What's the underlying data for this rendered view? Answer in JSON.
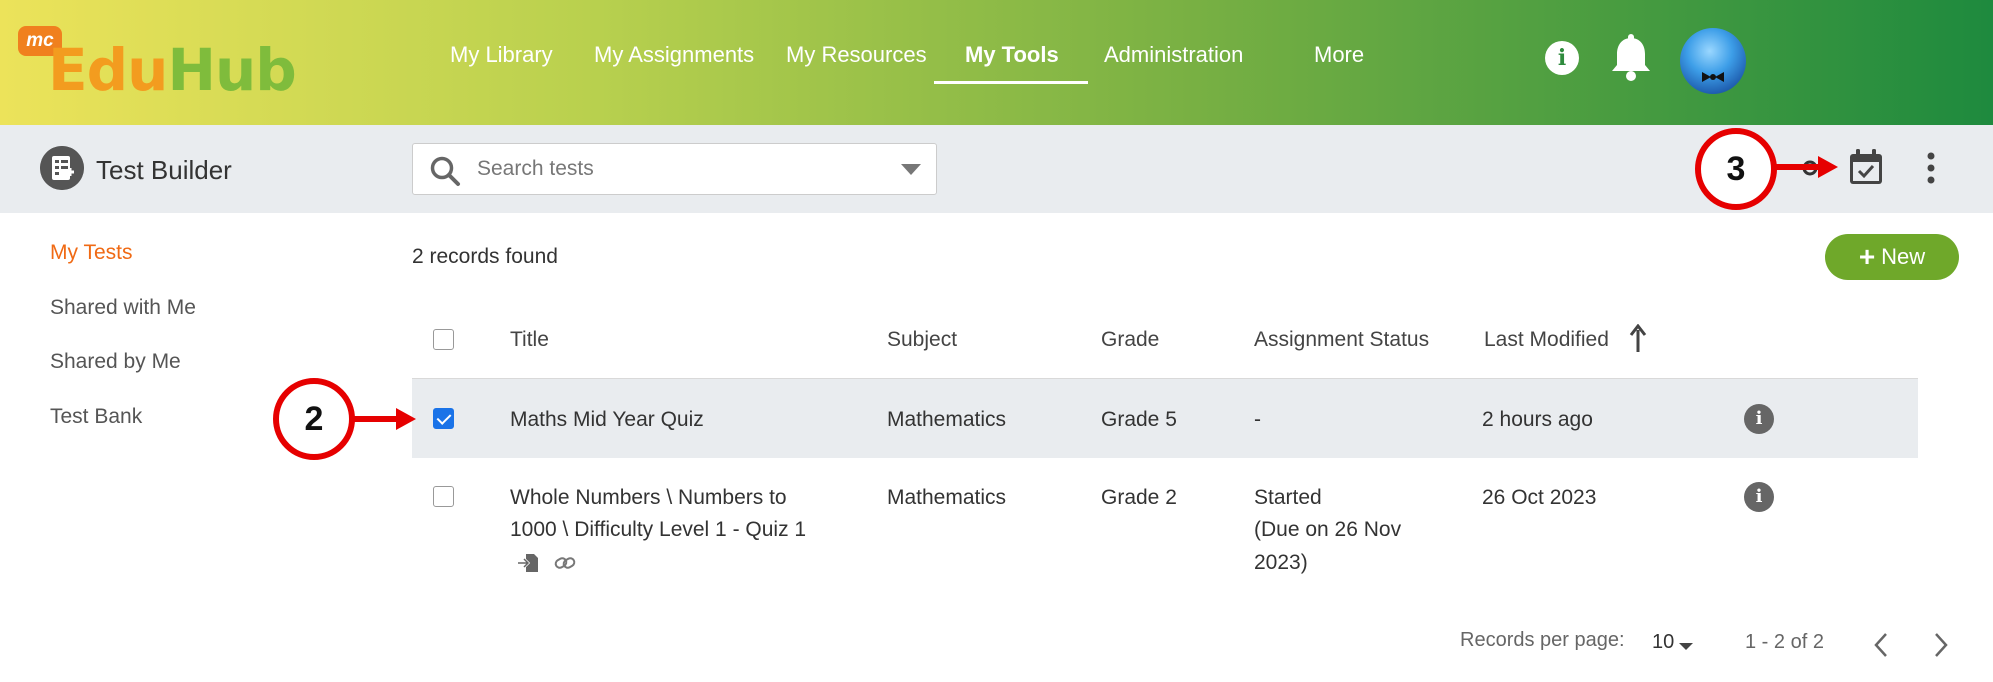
{
  "app": {
    "brand_badge": "mc",
    "brand_part1": "Edu",
    "brand_part2": "Hub"
  },
  "nav": {
    "items": [
      {
        "label": "My Library",
        "active": false
      },
      {
        "label": "My Assignments",
        "active": false
      },
      {
        "label": "My Resources",
        "active": false
      },
      {
        "label": "My Tools",
        "active": true
      },
      {
        "label": "Administration",
        "active": false
      },
      {
        "label": "More",
        "active": false
      }
    ],
    "info_glyph": "i"
  },
  "toolbar": {
    "title": "Test Builder",
    "search_placeholder": "Search tests",
    "icons": [
      "calendar-check-icon",
      "kebab-menu-icon"
    ]
  },
  "sidebar": {
    "items": [
      {
        "label": "My Tests",
        "active": true
      },
      {
        "label": "Shared with Me",
        "active": false
      },
      {
        "label": "Shared by Me",
        "active": false
      },
      {
        "label": "Test Bank",
        "active": false
      }
    ]
  },
  "main": {
    "records_found": "2 records found",
    "new_button": "New",
    "columns": [
      "Title",
      "Subject",
      "Grade",
      "Assignment Status",
      "Last Modified"
    ],
    "rows": [
      {
        "checked": true,
        "title_lines": [
          "Maths Mid Year Quiz"
        ],
        "subject": "Mathematics",
        "grade": "Grade 5",
        "status_lines": [
          "-"
        ],
        "last_modified": "2 hours ago"
      },
      {
        "checked": false,
        "title_lines": [
          "Whole Numbers \\ Numbers to",
          "1000 \\ Difficulty Level 1 - Quiz 1"
        ],
        "subject": "Mathematics",
        "grade": "Grade 2",
        "status_lines": [
          "Started",
          "(Due on 26 Nov",
          "2023)"
        ],
        "last_modified": "26 Oct 2023",
        "icons": [
          "file-import-icon",
          "link-icon"
        ]
      }
    ],
    "row_info_glyph": "i"
  },
  "pagination": {
    "per_page_label": "Records per page:",
    "per_page_value": "10",
    "range": "1 - 2 of 2"
  },
  "annotations": {
    "step_2": "2",
    "step_3": "3"
  },
  "colors": {
    "accent_orange": "#f06a14",
    "new_button_green": "#6fa82a",
    "annotation_red": "#e60000",
    "checkbox_blue": "#1a73e8"
  }
}
